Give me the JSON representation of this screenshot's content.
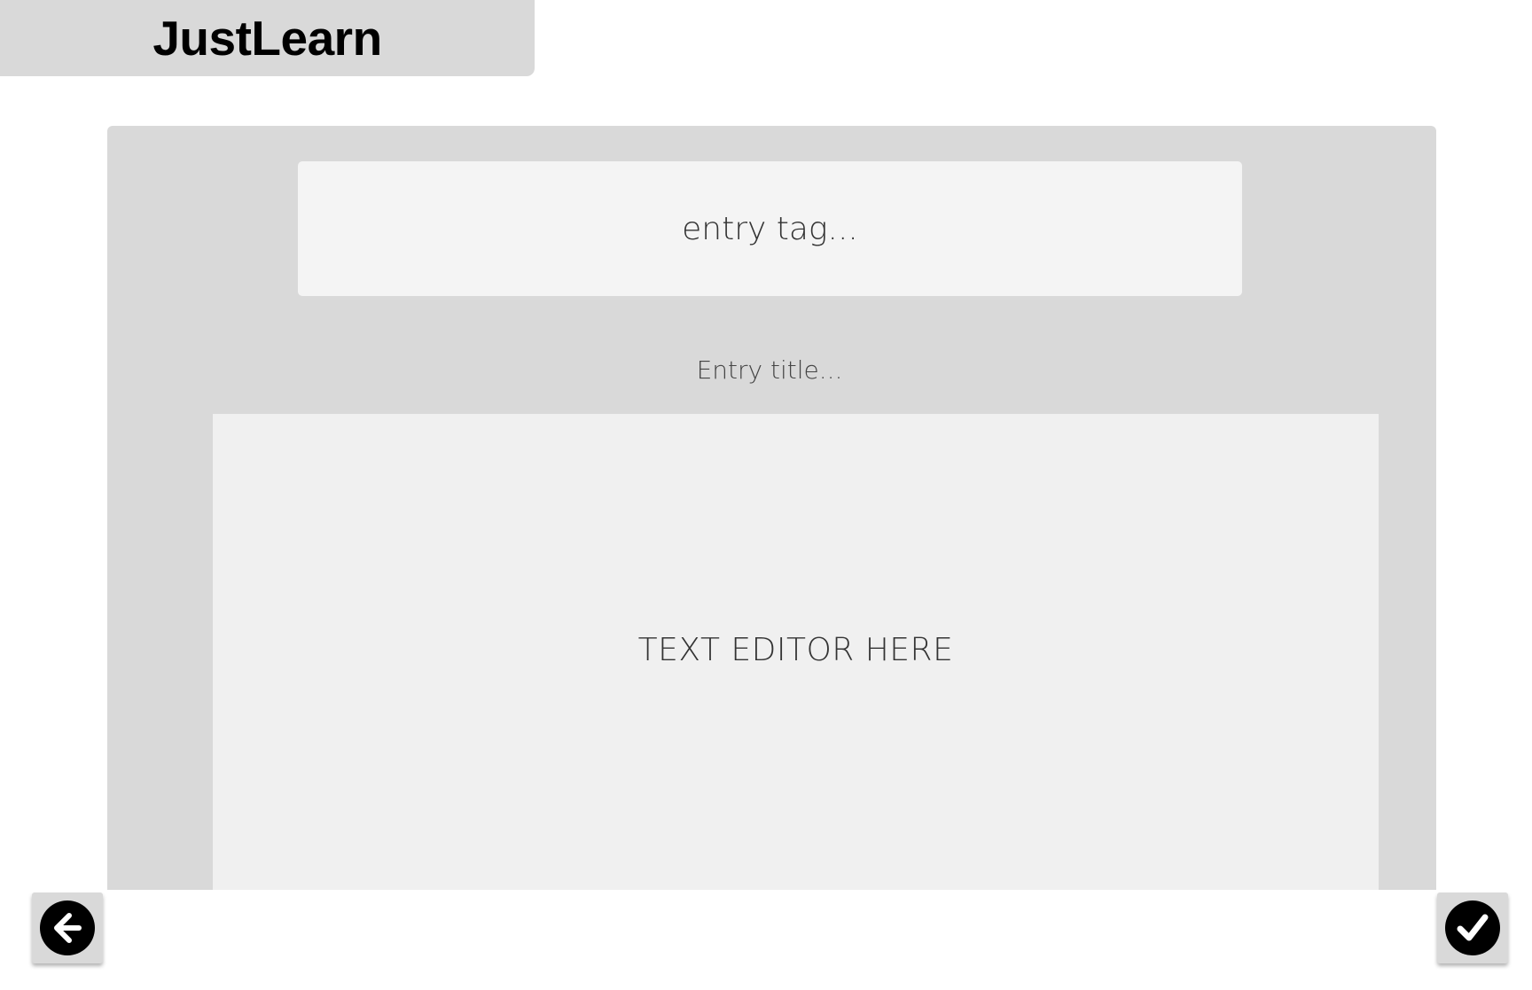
{
  "app": {
    "logo_text": "JustLearn"
  },
  "entry": {
    "tag_placeholder": "entry tag...",
    "title_placeholder": "Entry title...",
    "editor_placeholder": "TEXT EDITOR HERE"
  },
  "actions": {
    "back_icon": "arrow-left-circle-icon",
    "confirm_icon": "check-circle-icon"
  },
  "colors": {
    "panel_background": "#d9d9d9",
    "input_background": "#f4f4f4",
    "editor_background": "#f0f0f0",
    "icon_color": "#000000"
  }
}
